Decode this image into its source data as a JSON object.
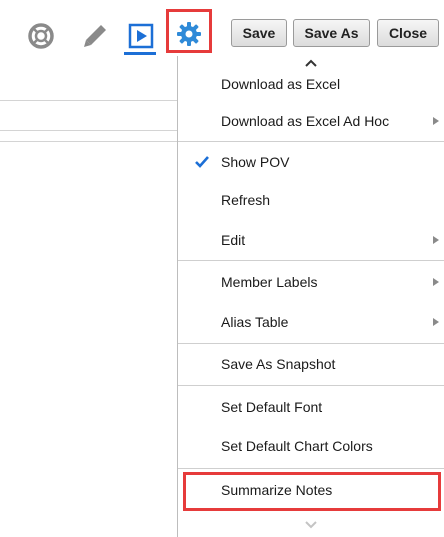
{
  "toolbar": {
    "icons": {
      "help": "lifebuoy-icon",
      "edit": "pencil-icon",
      "run": "play-icon",
      "settings": "gear-icon"
    },
    "save_label": "Save",
    "save_as_label": "Save As",
    "close_label": "Close"
  },
  "menu": {
    "items": [
      {
        "label": "Download as Excel",
        "submenu": false
      },
      {
        "label": "Download as Excel Ad Hoc",
        "submenu": true
      },
      {
        "label": "Show POV",
        "checked": true
      },
      {
        "label": "Refresh"
      },
      {
        "label": "Edit",
        "submenu": true
      },
      {
        "label": "Member Labels",
        "submenu": true
      },
      {
        "label": "Alias Table",
        "submenu": true
      },
      {
        "label": "Save As Snapshot"
      },
      {
        "label": "Set Default Font"
      },
      {
        "label": "Set Default Chart Colors"
      },
      {
        "label": "Summarize Notes",
        "highlighted": true
      }
    ]
  },
  "colors": {
    "accent": "#1c6fd6",
    "highlight": "#e63b3b",
    "gear": "#2f8ad8",
    "check": "#1c6fd6"
  }
}
